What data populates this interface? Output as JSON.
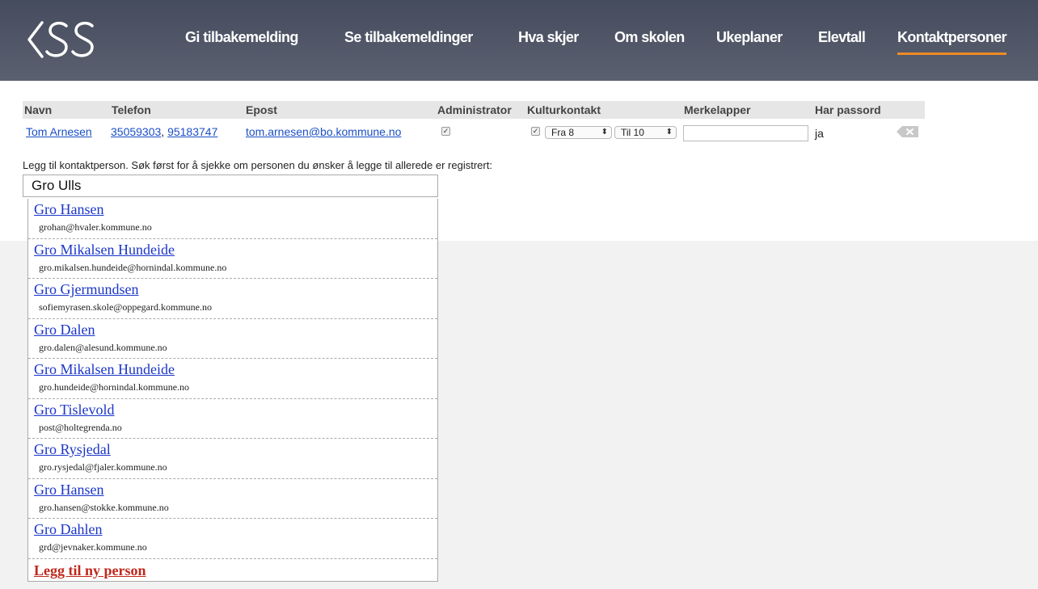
{
  "nav": {
    "items": [
      {
        "label": "Gi tilbakemelding"
      },
      {
        "label": "Se tilbakemeldinger"
      },
      {
        "label": "Hva skjer"
      },
      {
        "label": "Om skolen"
      },
      {
        "label": "Ukeplaner"
      },
      {
        "label": "Elevtall"
      },
      {
        "label": "Kontaktpersoner"
      }
    ],
    "active": "Kontaktpersoner",
    "accent_color": "#f08a24"
  },
  "table": {
    "headers": {
      "navn": "Navn",
      "telefon": "Telefon",
      "epost": "Epost",
      "administrator": "Administrator",
      "kulturkontakt": "Kulturkontakt",
      "merkelapper": "Merkelapper",
      "har_passord": "Har passord"
    },
    "row": {
      "navn": "Tom Arnesen",
      "telefon1": "35059303",
      "sep": ",",
      "telefon2": "95183747",
      "epost": "tom.arnesen@bo.kommune.no",
      "administrator": true,
      "kulturkontakt": true,
      "fra": "Fra 8",
      "til": "Til 10",
      "merkelapper": "",
      "har_passord": "ja"
    }
  },
  "add_contact": {
    "hint": "Legg til kontaktperson. Søk først for å sjekke om personen du ønsker å legge til allerede er registrert:",
    "search_value": "Gro Ulls",
    "suggestions": [
      {
        "name": "Gro Hansen",
        "email": "grohan@hvaler.kommune.no"
      },
      {
        "name": "Gro Mikalsen Hundeide",
        "email": "gro.mikalsen.hundeide@hornindal.kommune.no"
      },
      {
        "name": "Gro Gjermundsen",
        "email": "sofiemyrasen.skole@oppegard.kommune.no"
      },
      {
        "name": "Gro Dalen",
        "email": "gro.dalen@alesund.kommune.no"
      },
      {
        "name": "Gro Mikalsen Hundeide",
        "email": "gro.hundeide@hornindal.kommune.no"
      },
      {
        "name": "Gro Tislevold",
        "email": "post@holtegrenda.no"
      },
      {
        "name": "Gro Rysjedal",
        "email": "gro.rysjedal@fjaler.kommune.no"
      },
      {
        "name": "Gro Hansen",
        "email": "gro.hansen@stokke.kommune.no"
      },
      {
        "name": "Gro Dahlen",
        "email": "grd@jevnaker.kommune.no"
      }
    ],
    "add_new_label": "Legg til ny person"
  }
}
